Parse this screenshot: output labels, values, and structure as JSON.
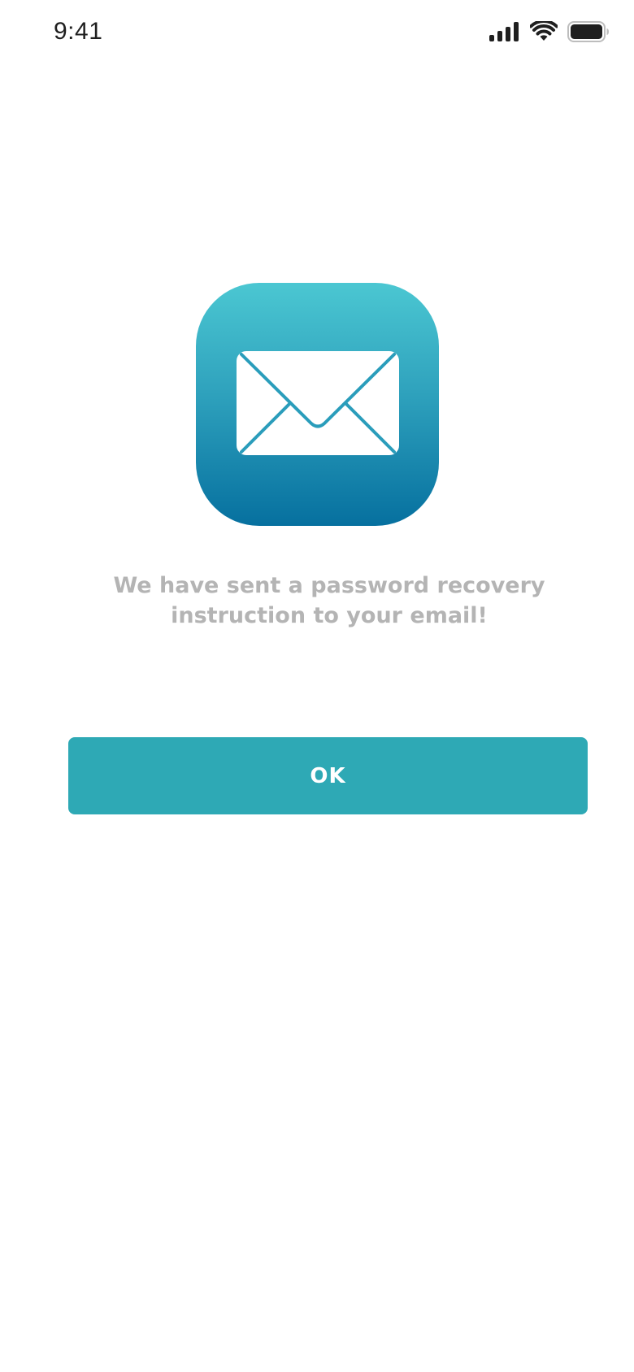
{
  "status_bar": {
    "time": "9:41",
    "icons": [
      "cellular-signal-icon",
      "wifi-icon",
      "battery-icon"
    ]
  },
  "hero": {
    "icon": "mail-icon",
    "gradient": [
      "#4bc7d2",
      "#2fa2bd",
      "#06709f"
    ]
  },
  "message": {
    "text": "We have sent a password recovery\ninstruction to your email!"
  },
  "actions": {
    "ok_label": "OK"
  },
  "colors": {
    "accent": "#2ea9b5",
    "message_text": "#b4b4b4",
    "status_text": "#1f1f1f",
    "background": "#ffffff"
  }
}
